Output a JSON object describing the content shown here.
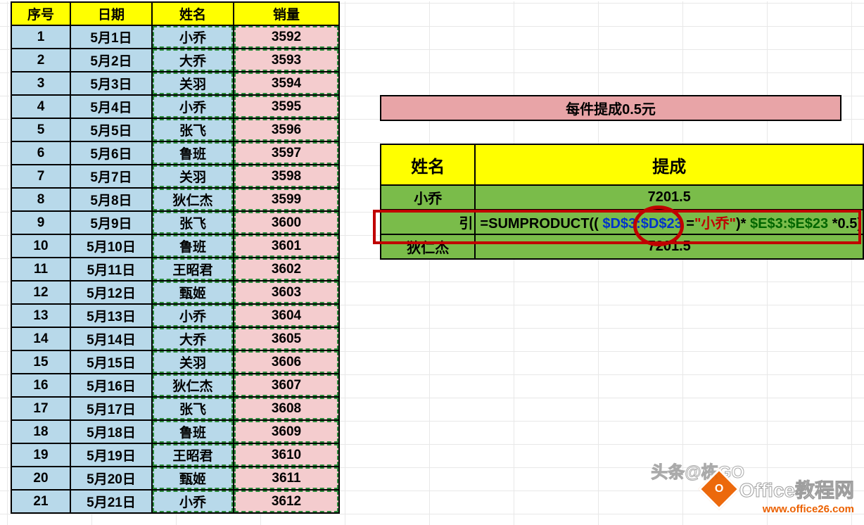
{
  "headers": {
    "a": "序号",
    "b": "日期",
    "c": "姓名",
    "d": "销量"
  },
  "rows": [
    {
      "n": "1",
      "date": "5月1日",
      "name": "小乔",
      "val": "3592"
    },
    {
      "n": "2",
      "date": "5月2日",
      "name": "大乔",
      "val": "3593"
    },
    {
      "n": "3",
      "date": "5月3日",
      "name": "关羽",
      "val": "3594"
    },
    {
      "n": "4",
      "date": "5月4日",
      "name": "小乔",
      "val": "3595"
    },
    {
      "n": "5",
      "date": "5月5日",
      "name": "张飞",
      "val": "3596"
    },
    {
      "n": "6",
      "date": "5月6日",
      "name": "鲁班",
      "val": "3597"
    },
    {
      "n": "7",
      "date": "5月7日",
      "name": "关羽",
      "val": "3598"
    },
    {
      "n": "8",
      "date": "5月8日",
      "name": "狄仁杰",
      "val": "3599"
    },
    {
      "n": "9",
      "date": "5月9日",
      "name": "张飞",
      "val": "3600"
    },
    {
      "n": "10",
      "date": "5月10日",
      "name": "鲁班",
      "val": "3601"
    },
    {
      "n": "11",
      "date": "5月11日",
      "name": "王昭君",
      "val": "3602"
    },
    {
      "n": "12",
      "date": "5月12日",
      "name": "甄姬",
      "val": "3603"
    },
    {
      "n": "13",
      "date": "5月13日",
      "name": "小乔",
      "val": "3604"
    },
    {
      "n": "14",
      "date": "5月14日",
      "name": "大乔",
      "val": "3605"
    },
    {
      "n": "15",
      "date": "5月15日",
      "name": "关羽",
      "val": "3606"
    },
    {
      "n": "16",
      "date": "5月16日",
      "name": "狄仁杰",
      "val": "3607"
    },
    {
      "n": "17",
      "date": "5月17日",
      "name": "张飞",
      "val": "3608"
    },
    {
      "n": "18",
      "date": "5月18日",
      "name": "鲁班",
      "val": "3609"
    },
    {
      "n": "19",
      "date": "5月19日",
      "name": "王昭君",
      "val": "3610"
    },
    {
      "n": "20",
      "date": "5月20日",
      "name": "甄姬",
      "val": "3611"
    },
    {
      "n": "21",
      "date": "5月21日",
      "name": "小乔",
      "val": "3612"
    }
  ],
  "banner": "每件提成0.5元",
  "sum_headers": {
    "name": "姓名",
    "bonus": "提成"
  },
  "sum_rows": [
    {
      "name": "小乔",
      "bonus": "7201.5"
    },
    {
      "name_trunc": "引",
      "formula": true
    },
    {
      "name": "狄仁杰",
      "bonus": "7201.5"
    }
  ],
  "formula": {
    "prefix": "=SUMPRODUCT(",
    "p_open": "(",
    "range1": " $D$3:$D$23 ",
    "eq": "=",
    "crit": "\"小乔\"",
    "p_close": ")",
    "mult1": "*",
    "range2": " $E$3:$E$23 ",
    "mult2": "*0.5)",
    "full_text": "=SUMPRODUCT(($D$3:$D$23=\"小乔\")*$E$3:$E$23*0.5)"
  },
  "watermark": {
    "head": "头条@栋GO",
    "brand": "Office教程网",
    "url": "www.office26.com",
    "logo": "O"
  }
}
